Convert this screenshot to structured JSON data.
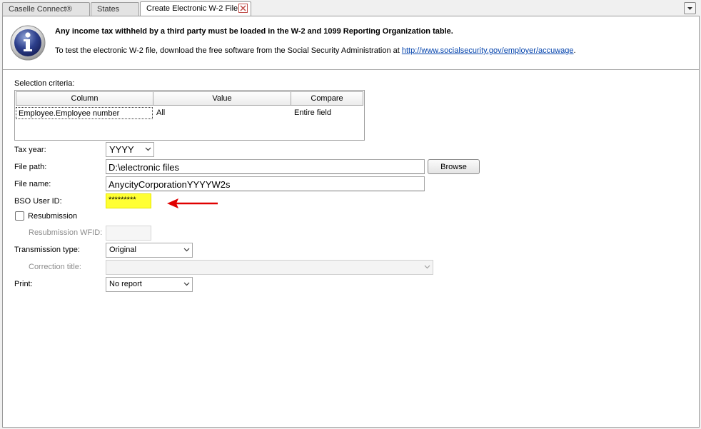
{
  "tabs": [
    {
      "label": "Caselle Connect®"
    },
    {
      "label": "States"
    },
    {
      "label": "Create Electronic W-2 File"
    }
  ],
  "info": {
    "headline": "Any income tax withheld by a third party must be loaded in the W-2 and 1099 Reporting Organization table.",
    "text_before": "To test the electronic W-2 file, download the free software from the Social Security Administration at ",
    "link": "http://www.socialsecurity.gov/employer/accuwage",
    "text_after": "."
  },
  "selection": {
    "label": "Selection criteria:",
    "columns": [
      "Column",
      "Value",
      "Compare"
    ],
    "rows": [
      [
        "Employee.Employee number",
        "All",
        "Entire field"
      ]
    ]
  },
  "form": {
    "tax_year_label": "Tax year:",
    "tax_year_value": "YYYY",
    "file_path_label": "File path:",
    "file_path_value": "D:\\electronic files",
    "browse_label": "Browse",
    "file_name_label": "File name:",
    "file_name_value": "AnycityCorporationYYYYW2s",
    "bso_label": "BSO User ID:",
    "bso_value": "*********",
    "resubmission_label": "Resubmission",
    "resubmission_checked": false,
    "resubmission_wfid_label": "Resubmission WFID:",
    "resubmission_wfid_value": "",
    "transmission_label": "Transmission type:",
    "transmission_value": "Original",
    "correction_label": "Correction title:",
    "correction_value": "",
    "print_label": "Print:",
    "print_value": "No report"
  },
  "colors": {
    "highlight": "#ffff33",
    "arrow": "#e00000",
    "link": "#0645ad"
  }
}
